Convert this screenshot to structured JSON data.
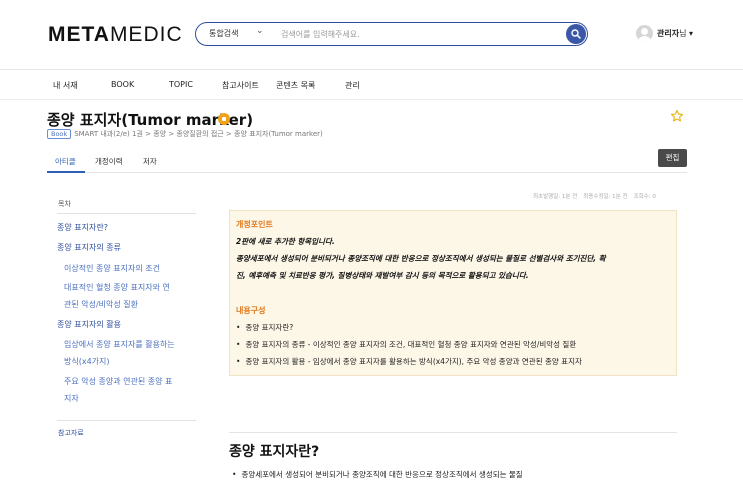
{
  "header": {
    "logo_bold": "META",
    "logo_light": "MEDIC",
    "search_scope": "통합검색",
    "search_placeholder": "검색어를 입력해주세요.",
    "user_name": "관리자",
    "user_suffix": "님 ▾"
  },
  "nav": {
    "items": [
      "내 서재",
      "BOOK",
      "TOPIC",
      "참고사이트",
      "콘텐츠 목록",
      "관리"
    ]
  },
  "article": {
    "title": "종양 표지자(Tumor marker)",
    "book_tag": "Book",
    "breadcrumb": "SMART 내과(2/e) 1권 > 종양 > 종양질환의 접근 > 종양 표지자(Tumor marker)",
    "tabs": [
      "아티클",
      "개정이력",
      "저자"
    ],
    "edit_label": "편집",
    "meta": {
      "first_published": "최초발행일: 1분 전",
      "last_modified": "최종수정일: 1분 전",
      "views": "조회수: 0"
    }
  },
  "toc": {
    "label": "목차",
    "items": [
      {
        "label": "종양 표지자란?",
        "level": 1
      },
      {
        "label": "종양 표지자의 종류",
        "level": 1
      },
      {
        "label": "이상적인 종양 표지자의 조건",
        "level": 2
      },
      {
        "label": "대표적인 혈청 종양 표지자와 연",
        "level": 2
      },
      {
        "label": "관된 악성/비악성 질환",
        "level": 2
      },
      {
        "label": "종양 표지자의 활용",
        "level": 1
      },
      {
        "label": "임상에서 종양 표지자를 활용하는",
        "level": 2
      },
      {
        "label": "방식(x4가지)",
        "level": 2
      },
      {
        "label": "주요 악성 종양과 연관된 종양 표",
        "level": 2
      },
      {
        "label": "지자",
        "level": 2
      }
    ],
    "references": "참고자료"
  },
  "notice": {
    "revision_head": "개정포인트",
    "revision_line1": "2판에 새로 추가한 항목입니다.",
    "revision_line2": "종양세포에서 생성되어 분비되거나 종양조직에 대한 반응으로 정상조직에서 생성되는 물질로 선별검사와 조기진단, 확",
    "revision_line3": "진, 예후예측 및 치료반응 평가, 질병상태와 재발여부 감시 등의 목적으로 활용되고 있습니다.",
    "content_head": "내용구성",
    "content_items": [
      "종양 표지자란?",
      "종양 표지자의 종류 - 이상적인 종양 표지자의 조건, 대표적인 혈청 종양 표지자와 연관된 악성/비악성 질환",
      "종양 표지자의 활용 - 임상에서 종양 표지자를 활용하는 방식(x4가지), 주요 악성 종양과 연관된 종양 표지자"
    ]
  },
  "section": {
    "title": "종양 표지자란?",
    "first_bullet": "종양세포에서 생성되어 분비되거나 종양조직에 대한 반응으로 정상조직에서 생성되는 물질"
  },
  "colors": {
    "primary": "#2f4e9e",
    "accent": "#e07a1f",
    "notice_bg": "#fdf7e8"
  }
}
